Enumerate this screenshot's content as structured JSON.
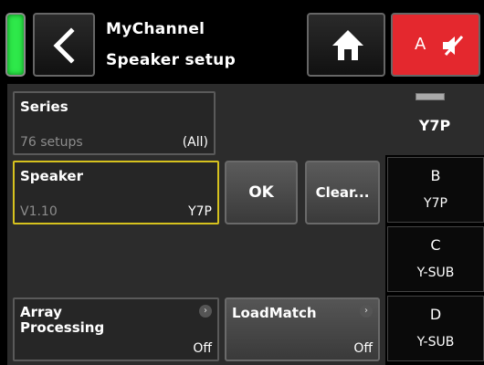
{
  "header": {
    "channel_name": "MyChannel",
    "page_title": "Speaker setup",
    "mute_button_letter": "A",
    "colors": {
      "signal_led": "#2ee84a",
      "mute_button": "#e4282e"
    }
  },
  "series": {
    "label": "Series",
    "count_text": "76 setups",
    "filter": "(All)"
  },
  "speaker": {
    "label": "Speaker",
    "version": "V1.10",
    "model": "Y7P",
    "highlight_color": "#d6c21e"
  },
  "buttons": {
    "ok": "OK",
    "clear": "Clear..."
  },
  "array_processing": {
    "label": "Array Processing",
    "value": "Off"
  },
  "loadmatch": {
    "label": "LoadMatch",
    "value": "Off"
  },
  "sidebar": {
    "current_model": "Y7P",
    "channels": [
      {
        "letter": "B",
        "model": "Y7P"
      },
      {
        "letter": "C",
        "model": "Y-SUB"
      },
      {
        "letter": "D",
        "model": "Y-SUB"
      }
    ]
  },
  "icons": {
    "back": "chevron-left-icon",
    "home": "home-icon",
    "mute": "speaker-muted-icon",
    "info": "info-icon"
  }
}
